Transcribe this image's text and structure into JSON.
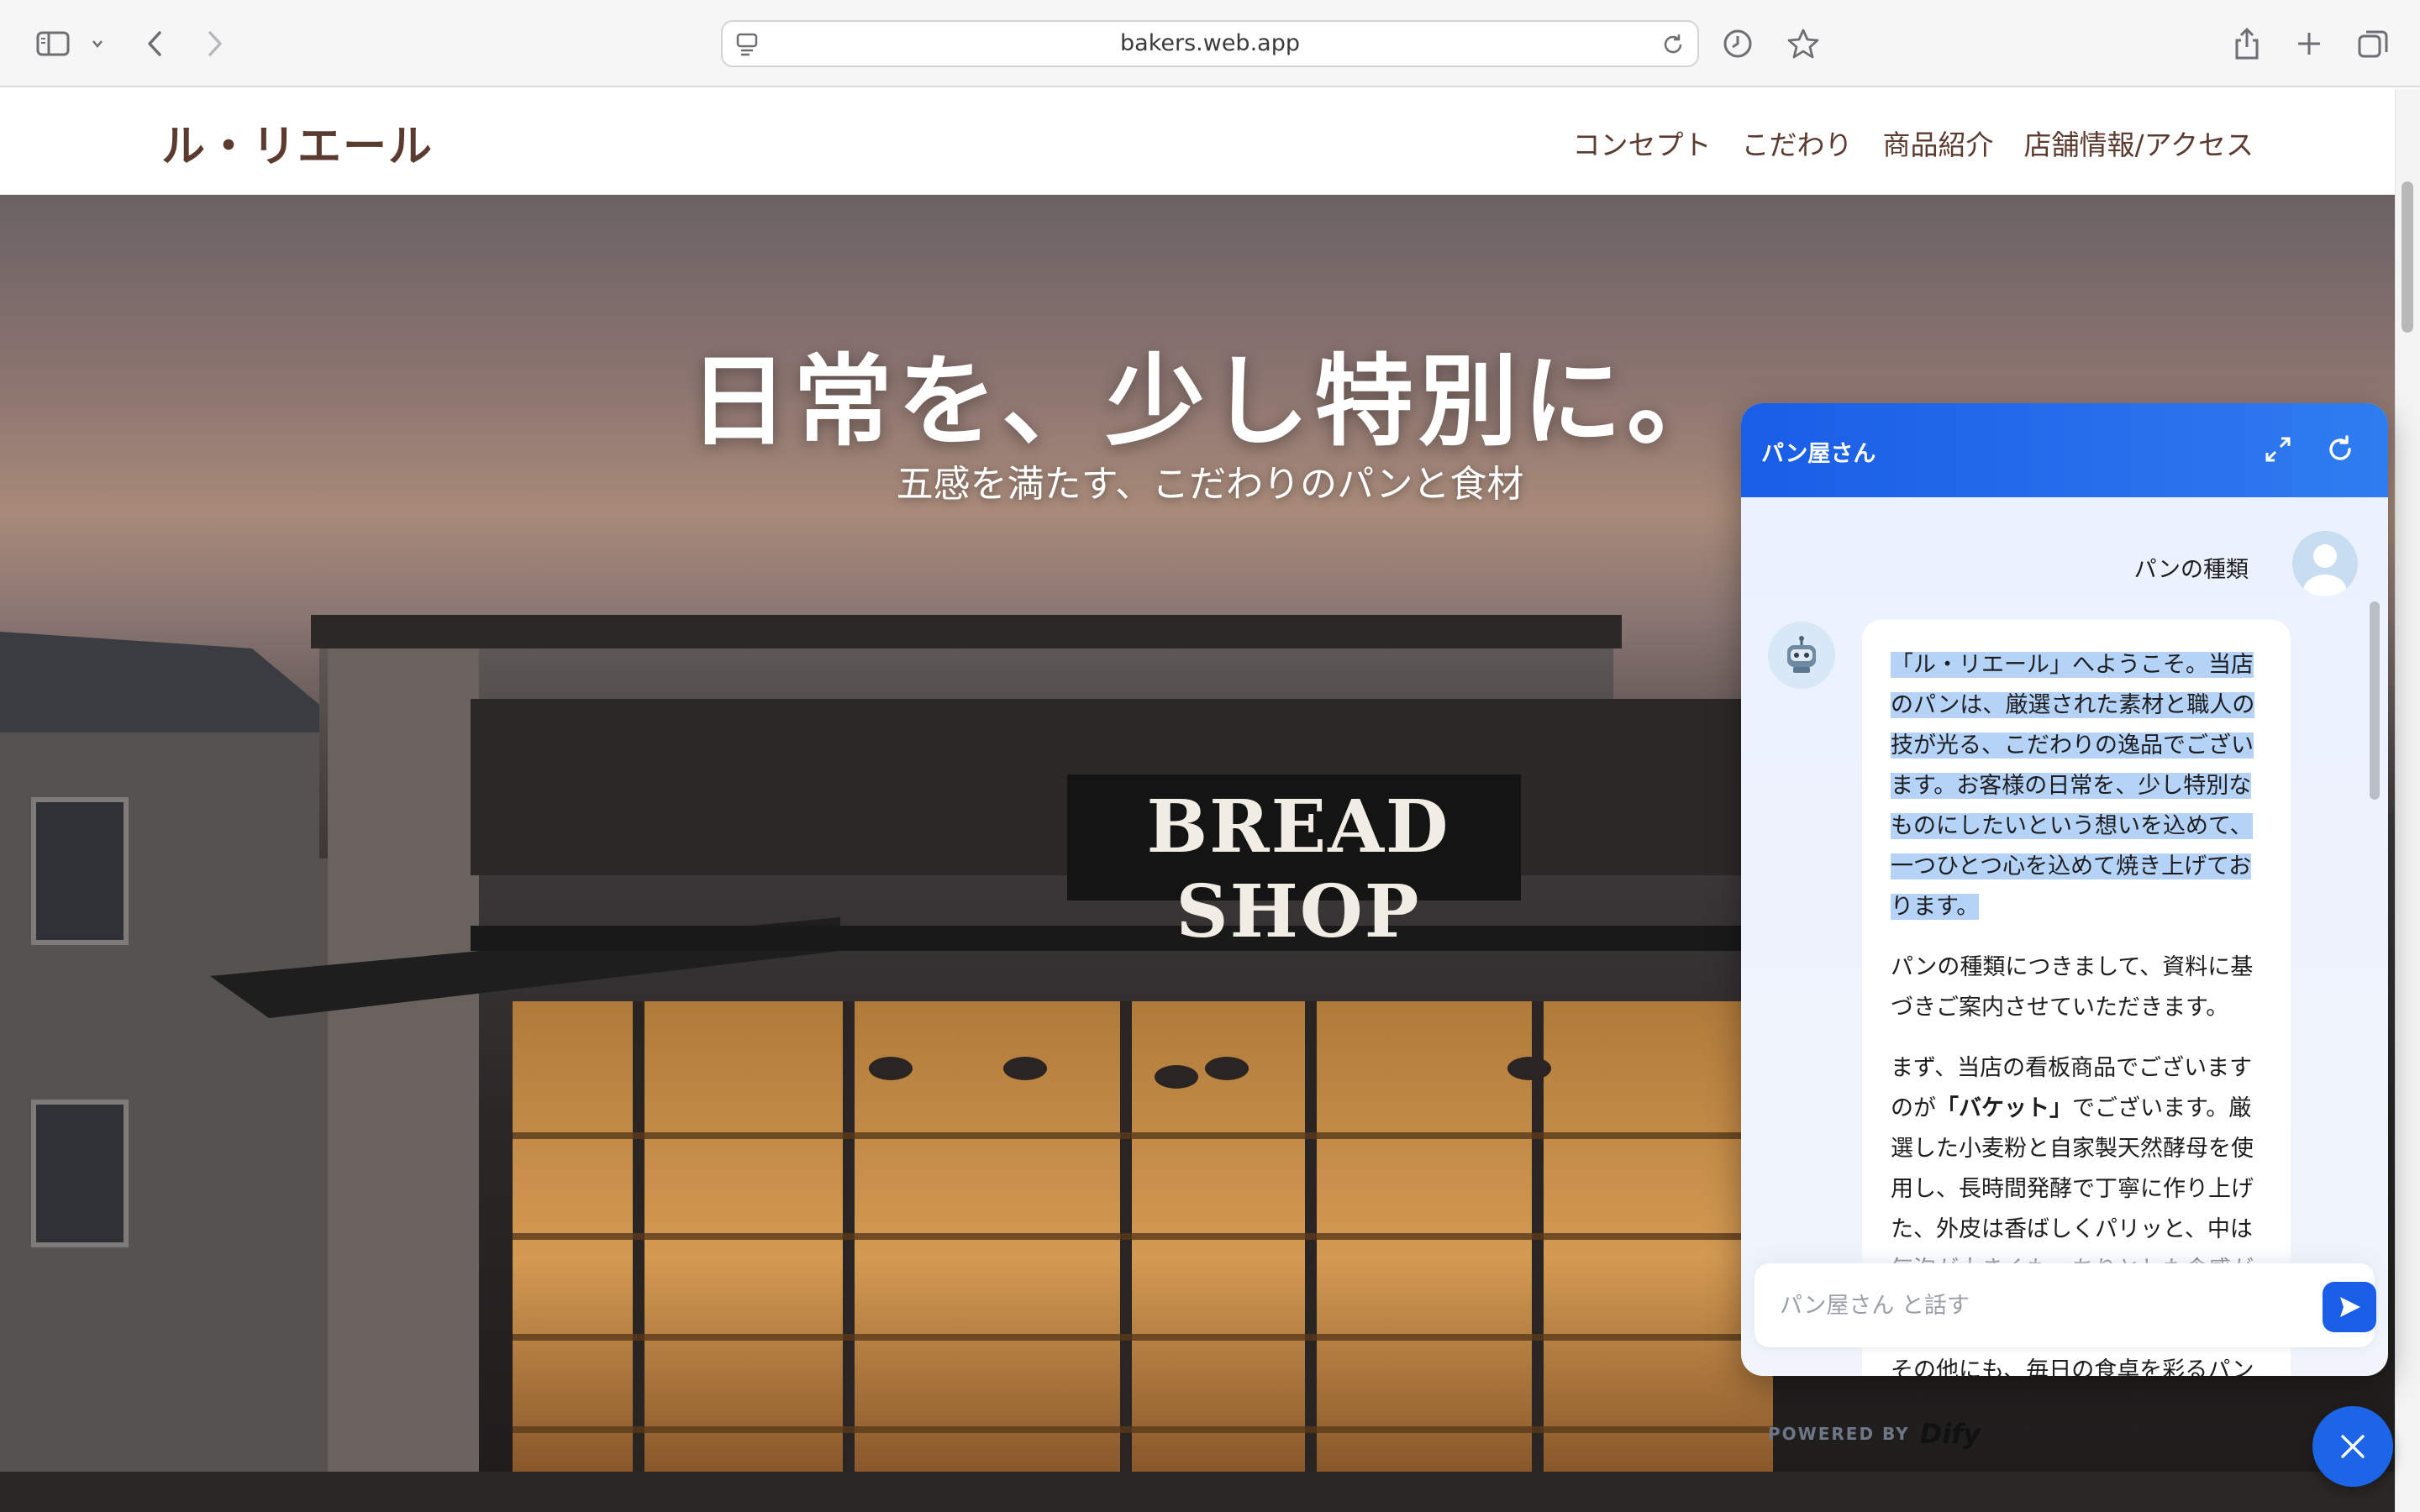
{
  "browser": {
    "url": "bakers.web.app",
    "icons": [
      "sidebar-icon",
      "chevron-down-icon",
      "back-icon",
      "forward-icon",
      "site-settings-icon",
      "reload-icon",
      "history-icon",
      "bookmark-star-icon",
      "share-icon",
      "new-tab-icon",
      "tab-overview-icon"
    ]
  },
  "site": {
    "logo": "ル・リエール",
    "nav": [
      "コンセプト",
      "こだわり",
      "商品紹介",
      "店舗情報/アクセス"
    ]
  },
  "hero": {
    "title": "日常を、少し特別に。",
    "subtitle": "五感を満たす、こだわりのパンと食材",
    "sign": "BREAD SHOP"
  },
  "chat": {
    "title": "パン屋さん",
    "user_message": "パンの種類",
    "bot_paragraph_1": "「ル・リエール」へようこそ。当店のパンは、厳選された素材と職人の技が光る、こだわりの逸品でございます。お客様の日常を、少し特別なものにしたいという想いを込めて、一つひとつ心を込めて焼き上げております。",
    "bot_paragraph_2": "パンの種類につきまして、資料に基づきご案内させていただきます。",
    "bot_paragraph_3_before": "まず、当店の看板商品でございますのが",
    "bot_paragraph_3_bold": "「バケット」",
    "bot_paragraph_3_after": "でございます。厳選した小麦粉と自家製天然酵母を使用し、長時間発酵で丁寧に作り上げた、外皮は香ばしくパリッと、中は気泡が大きくもっちりとした食感が特徴でございます。",
    "bot_paragraph_4": "その他にも、毎日の食卓を彩るパン",
    "input_placeholder": "パン屋さん と話す",
    "powered_by": "POWERED BY",
    "powered_logo": "Dify"
  },
  "colors": {
    "brand_brown": "#5b3b30",
    "chat_blue": "#1a5de6",
    "highlight": "#b5d3f7"
  }
}
